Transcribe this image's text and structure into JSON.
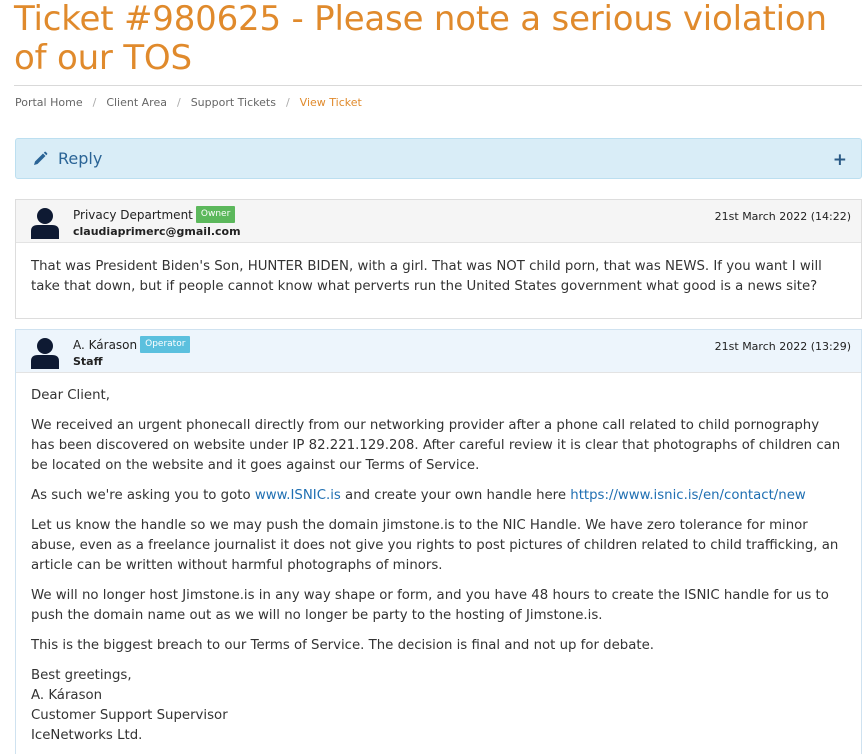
{
  "page": {
    "title": "Ticket #980625 - Please note a serious violation of our TOS"
  },
  "breadcrumb": {
    "items": [
      "Portal Home",
      "Client Area",
      "Support Tickets"
    ],
    "active": "View Ticket",
    "separator": "/"
  },
  "reply": {
    "label": "Reply",
    "toggle": "+",
    "icon": "pencil-icon"
  },
  "messages": [
    {
      "name": "Privacy Department",
      "badge": "Owner",
      "sub": "claudiaprimerc@gmail.com",
      "date": "21st March 2022 (14:22)",
      "body": "That was President Biden's Son, HUNTER BIDEN, with a girl. That was NOT child porn, that was NEWS. If you want I will take that down, but if people cannot know what perverts run the United States government what good is a news site?"
    },
    {
      "name": "A. Kárason",
      "badge": "Operator",
      "sub": "Staff",
      "date": "21st March 2022 (13:29)",
      "greeting": "Dear Client,",
      "p1": "We received an urgent phonecall directly from our networking provider after a phone call related to child pornography has been discovered on website under IP 82.221.129.208. After careful review it is clear that photographs of children can be located on the website and it goes against our Terms of Service.",
      "p2_pre": "As such we're asking you to goto ",
      "p2_link1": "www.ISNIC.is",
      "p2_mid": " and create your own handle here ",
      "p2_link2": "https://www.isnic.is/en/contact/new",
      "p3": "Let us know the handle so we may push the domain jimstone.is to the NIC Handle. We have zero tolerance for minor abuse, even as a freelance journalist it does not give you rights to post pictures of children related to child trafficking, an article can be written without harmful photographs of minors.",
      "p4": "We will no longer host Jimstone.is in any way shape or form, and you have 48 hours to create the ISNIC handle for us to push the domain name out as we will no longer be party to the hosting of Jimstone.is.",
      "p5": "This is the biggest breach to our Terms of Service. The decision is final and not up for debate.",
      "sig": [
        "Best greetings,",
        "A. Kárason",
        "Customer Support Supervisor",
        "IceNetworks Ltd."
      ]
    }
  ],
  "colors": {
    "accent": "#e08a2c",
    "link": "#1f6fb2",
    "owner_badge": "#5cb85c",
    "operator_badge": "#5bc0de",
    "reply_bg": "#d9edf7"
  }
}
